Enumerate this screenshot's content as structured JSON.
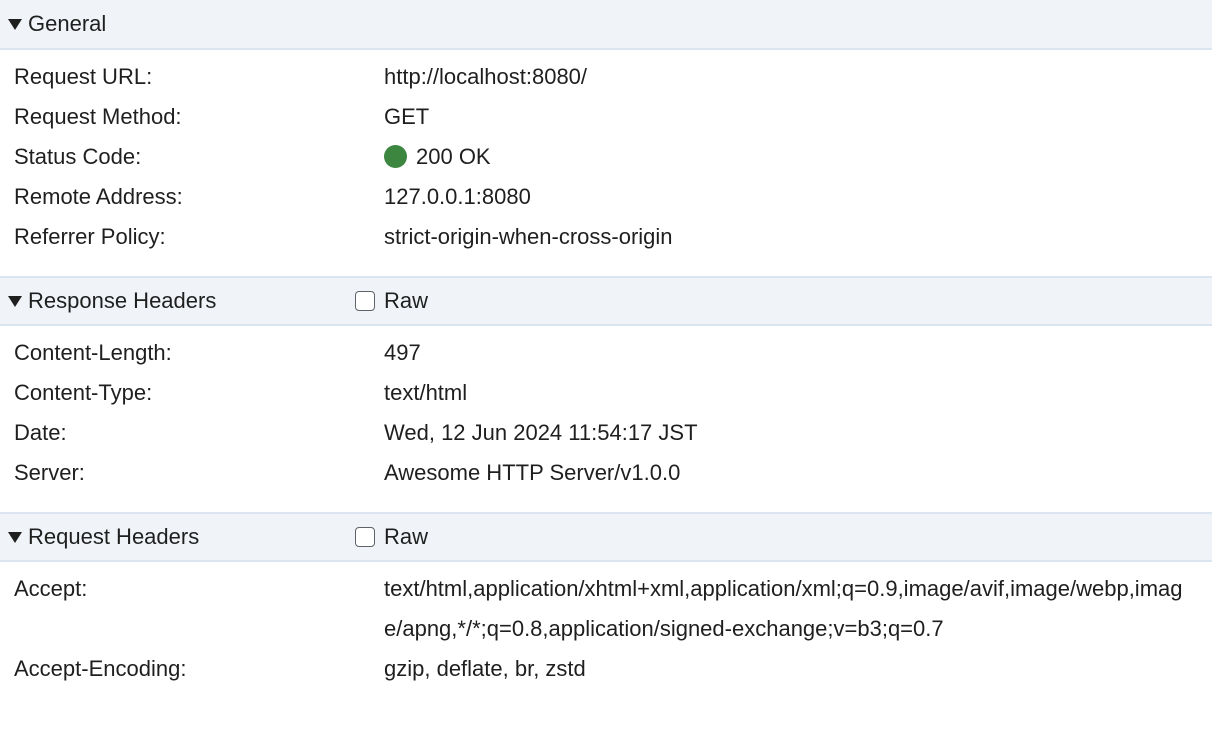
{
  "general": {
    "title": "General",
    "rows": [
      {
        "key": "Request URL:",
        "value": "http://localhost:8080/"
      },
      {
        "key": "Request Method:",
        "value": "GET"
      },
      {
        "key": "Status Code:",
        "value": "200 OK"
      },
      {
        "key": "Remote Address:",
        "value": "127.0.0.1:8080"
      },
      {
        "key": "Referrer Policy:",
        "value": "strict-origin-when-cross-origin"
      }
    ],
    "status_color": "#3d8640"
  },
  "response_headers": {
    "title": "Response Headers",
    "raw_label": "Raw",
    "raw_checked": false,
    "rows": [
      {
        "key": "Content-Length:",
        "value": "497"
      },
      {
        "key": "Content-Type:",
        "value": "text/html"
      },
      {
        "key": "Date:",
        "value": "Wed, 12 Jun 2024 11:54:17 JST"
      },
      {
        "key": "Server:",
        "value": "Awesome HTTP Server/v1.0.0"
      }
    ]
  },
  "request_headers": {
    "title": "Request Headers",
    "raw_label": "Raw",
    "raw_checked": false,
    "rows": [
      {
        "key": "Accept:",
        "value": "text/html,application/xhtml+xml,application/xml;q=0.9,image/avif,image/webp,image/apng,*/*;q=0.8,application/signed-exchange;v=b3;q=0.7"
      },
      {
        "key": "Accept-Encoding:",
        "value": "gzip, deflate, br, zstd"
      }
    ]
  }
}
